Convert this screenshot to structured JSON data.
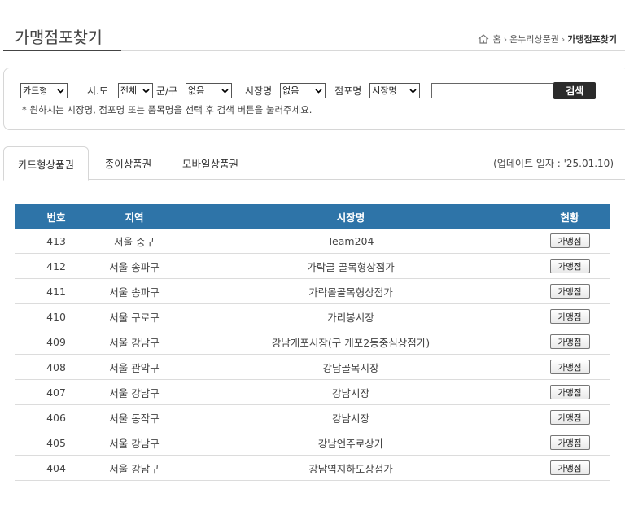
{
  "header": {
    "title": "가맹점포찾기",
    "breadcrumb": {
      "home": "홈",
      "section": "온누리상품권",
      "current": "가맹점포찾기"
    }
  },
  "search": {
    "card_type_select": "카드형",
    "sido_label": "시.도",
    "sido_select": "전체",
    "gungu_label": "군/구",
    "gungu_select": "없음",
    "market_label": "시장명",
    "market_select": "없음",
    "store_label": "점포명",
    "store_select": "시장명",
    "keyword_value": "",
    "search_button": "검색",
    "hint": "* 원하시는 시장명, 점포명 또는 품목명을 선택 후 검색 버튼을 눌러주세요."
  },
  "tabs": {
    "items": [
      "카드형상품권",
      "종이상품권",
      "모바일상품권"
    ],
    "active_index": 0,
    "update_text": "(업데이트 일자 : '25.01.10)"
  },
  "table": {
    "headers": [
      "번호",
      "지역",
      "시장명",
      "현황"
    ],
    "button_label": "가맹점",
    "rows": [
      {
        "no": "413",
        "region": "서울 중구",
        "market": "Team204"
      },
      {
        "no": "412",
        "region": "서울 송파구",
        "market": "가락골 골목형상점가"
      },
      {
        "no": "411",
        "region": "서울 송파구",
        "market": "가락몰골목형상점가"
      },
      {
        "no": "410",
        "region": "서울 구로구",
        "market": "가리봉시장"
      },
      {
        "no": "409",
        "region": "서울 강남구",
        "market": "강남개포시장(구 개포2동중심상점가)"
      },
      {
        "no": "408",
        "region": "서울 관악구",
        "market": "강남골목시장"
      },
      {
        "no": "407",
        "region": "서울 강남구",
        "market": "강남시장"
      },
      {
        "no": "406",
        "region": "서울 동작구",
        "market": "강남시장"
      },
      {
        "no": "405",
        "region": "서울 강남구",
        "market": "강남언주로상가"
      },
      {
        "no": "404",
        "region": "서울 강남구",
        "market": "강남역지하도상점가"
      }
    ]
  },
  "colors": {
    "table_header": "#2e74a8",
    "search_button": "#2b2b2b"
  }
}
